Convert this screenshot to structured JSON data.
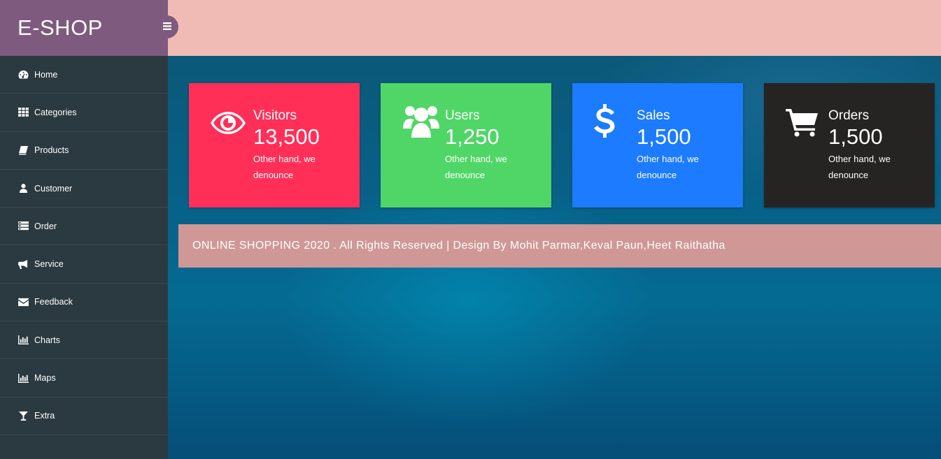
{
  "brand": {
    "title": "E-SHOP"
  },
  "sidebar": {
    "items": [
      {
        "label": "Home",
        "icon": "dashboard-icon"
      },
      {
        "label": "Categories",
        "icon": "grid-icon"
      },
      {
        "label": "Products",
        "icon": "book-icon"
      },
      {
        "label": "Customer",
        "icon": "user-icon"
      },
      {
        "label": "Order",
        "icon": "list-icon"
      },
      {
        "label": "Service",
        "icon": "bullhorn-icon"
      },
      {
        "label": "Feedback",
        "icon": "envelope-icon"
      },
      {
        "label": "Charts",
        "icon": "bar-chart-icon"
      },
      {
        "label": "Maps",
        "icon": "bar-chart-icon"
      },
      {
        "label": "Extra",
        "icon": "glass-icon"
      }
    ]
  },
  "cards": [
    {
      "title": "Visitors",
      "value": "13,500",
      "description": "Other hand, we denounce",
      "icon": "eye-icon",
      "color": "#ff2f58"
    },
    {
      "title": "Users",
      "value": "1,250",
      "description": "Other hand, we denounce",
      "icon": "users-icon",
      "color": "#50d667"
    },
    {
      "title": "Sales",
      "value": "1,500",
      "description": "Other hand, we denounce",
      "icon": "dollar-icon",
      "color": "#1c7bff"
    },
    {
      "title": "Orders",
      "value": "1,500",
      "description": "Other hand, we denounce",
      "icon": "cart-icon",
      "color": "#252422"
    }
  ],
  "footer": {
    "text": "ONLINE SHOPPING 2020 . All Rights Reserved | Design By Mohit Parmar,Keval Paun,Heet Raithatha"
  },
  "colors": {
    "sidebar": "#2b3a40",
    "brand": "#7d5a7e",
    "topbar": "#f0bbb4",
    "footer": "#cf9896"
  }
}
